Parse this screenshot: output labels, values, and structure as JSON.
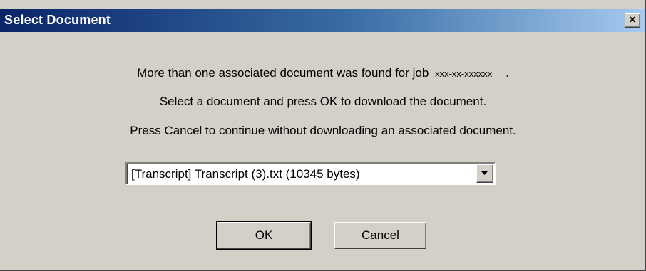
{
  "window": {
    "title": "Select Document",
    "close_glyph": "×",
    "title_gradient": [
      "#0a246a",
      "#a6caf0"
    ],
    "face_color": "#d4d0c8"
  },
  "message": {
    "line1": "More than one associated document was found for job ",
    "job_id": "xxx-xx-xxxxxx",
    "line1_end": "    .",
    "line2": "Select a document and press OK to download the document.",
    "line3": "Press Cancel to continue without downloading an associated document."
  },
  "document_select": {
    "selected": "[Transcript] Transcript (3).txt (10345 bytes)",
    "arrow_icon": "chevron-down-icon"
  },
  "buttons": {
    "ok_label": "OK",
    "cancel_label": "Cancel"
  }
}
